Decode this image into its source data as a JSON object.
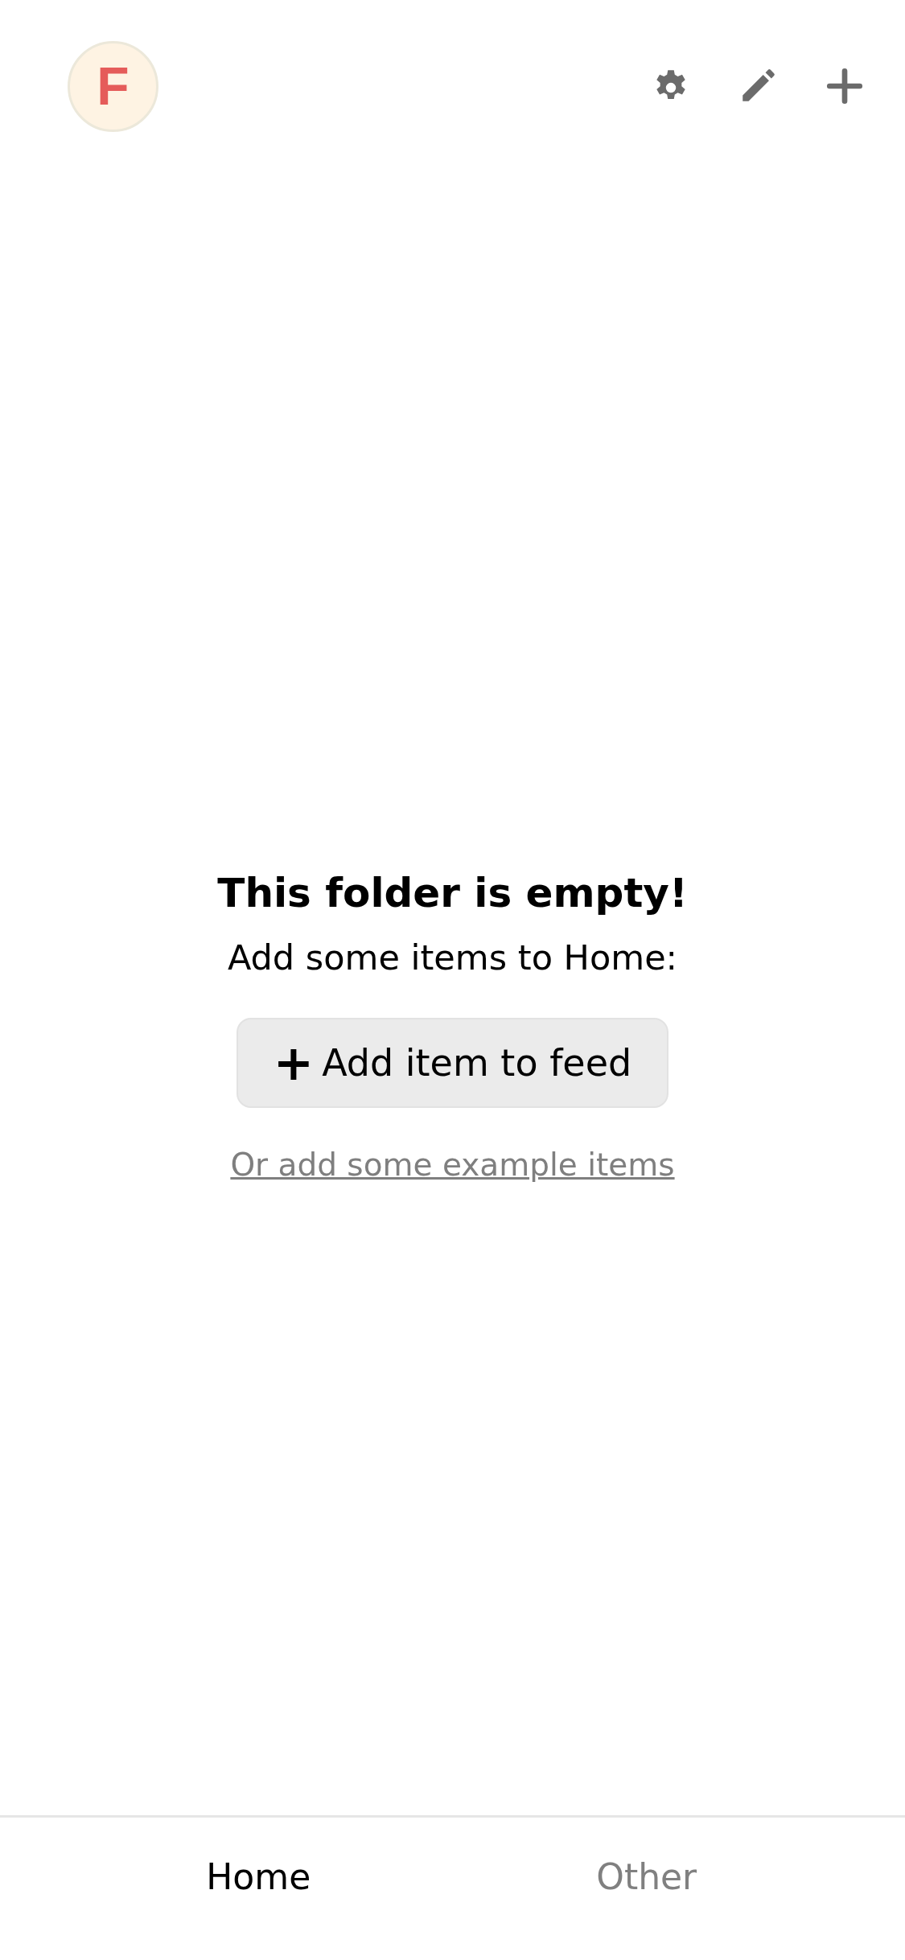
{
  "header": {
    "logo": {
      "letter": "F"
    },
    "actions": [
      {
        "kind": "settings"
      },
      {
        "kind": "edit"
      },
      {
        "kind": "add"
      }
    ]
  },
  "empty_state": {
    "title": "This folder is empty!",
    "message": "Add some items to Home:",
    "button": {
      "icon": "+",
      "label": "Add item to feed"
    },
    "link": "Or add some example items"
  },
  "tabs": [
    {
      "label": "Home",
      "selected": true
    },
    {
      "label": "Other",
      "selected": false
    }
  ]
}
